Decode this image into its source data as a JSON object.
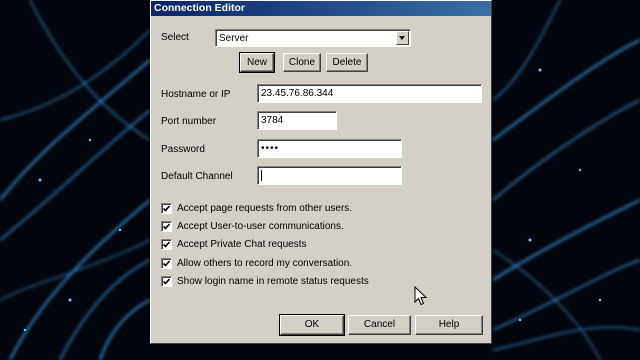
{
  "dialog": {
    "title": "Connection Editor",
    "select_label": "Select",
    "select_value": "Server",
    "buttons": {
      "new": "New",
      "clone": "Clone",
      "delete": "Delete"
    },
    "fields": {
      "hostname_label": "Hostname or IP",
      "hostname_value": "23.45.76.86.344",
      "port_label": "Port number",
      "port_value": "3784",
      "password_label": "Password",
      "password_value": "••••",
      "channel_label": "Default Channel",
      "channel_value": ""
    },
    "options": [
      {
        "label": "Accept page requests from other users.",
        "checked": true
      },
      {
        "label": "Accept User-to-user communications.",
        "checked": true
      },
      {
        "label": "Accept Private Chat requests",
        "checked": true
      },
      {
        "label": "Allow others to record my conversation.",
        "checked": true
      },
      {
        "label": "Show login name in remote status requests",
        "checked": true
      }
    ],
    "footer": {
      "ok": "OK",
      "cancel": "Cancel",
      "help": "Help"
    }
  },
  "colors": {
    "titlebar": "#0a246a",
    "face": "#d4d0c8",
    "glow": "#3fa9ff"
  }
}
